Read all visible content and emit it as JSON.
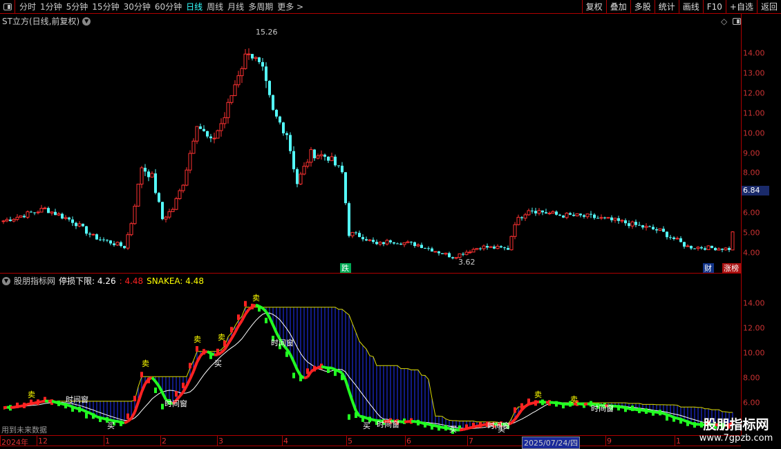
{
  "toolbar": {
    "periods": [
      "分时",
      "1分钟",
      "5分钟",
      "15分钟",
      "30分钟",
      "60分钟",
      "日线",
      "周线",
      "月线",
      "多周期",
      "更多 >"
    ],
    "active": "日线",
    "right_buttons": [
      "复权",
      "叠加",
      "多股",
      "统计",
      "画线",
      "F10",
      "+自选",
      "返回"
    ]
  },
  "main_chart": {
    "title": "ST立方(日线,前复权)",
    "yticks": [
      "14.00",
      "13.00",
      "12.00",
      "11.00",
      "10.00",
      "9.00",
      "8.00",
      "6.00",
      "5.00",
      "4.00"
    ],
    "current_price": "6.84",
    "high_label": "15.26",
    "low_label": "3.62",
    "markers": {
      "die": "跌",
      "cai": "财",
      "zhangbang": "涨榜"
    },
    "price_path": [
      [
        0,
        5.6
      ],
      [
        12,
        6.2
      ],
      [
        20,
        5.6
      ],
      [
        26,
        4.8
      ],
      [
        35,
        4.3
      ],
      [
        37,
        5.5
      ],
      [
        40,
        8.3
      ],
      [
        43,
        7.8
      ],
      [
        46,
        5.7
      ],
      [
        49,
        6.2
      ],
      [
        52,
        7.5
      ],
      [
        56,
        10.5
      ],
      [
        60,
        9.5
      ],
      [
        64,
        10.8
      ],
      [
        68,
        13.0
      ],
      [
        71,
        14.2
      ],
      [
        75,
        13.0
      ],
      [
        78,
        11.0
      ],
      [
        82,
        10.0
      ],
      [
        85,
        7.5
      ],
      [
        89,
        9.0
      ],
      [
        94,
        8.8
      ],
      [
        98,
        8.0
      ],
      [
        100,
        5.0
      ],
      [
        104,
        4.8
      ],
      [
        108,
        4.4
      ],
      [
        112,
        4.6
      ],
      [
        120,
        4.4
      ],
      [
        130,
        3.8
      ],
      [
        138,
        4.3
      ],
      [
        146,
        4.2
      ],
      [
        148,
        5.5
      ],
      [
        152,
        6.2
      ],
      [
        160,
        5.9
      ],
      [
        170,
        5.8
      ],
      [
        180,
        5.5
      ],
      [
        190,
        5.1
      ],
      [
        198,
        4.3
      ],
      [
        210,
        4.2
      ],
      [
        211,
        5.0
      ]
    ],
    "colors": {
      "up": "#ff3232",
      "down": "#54fcfc"
    }
  },
  "indicator": {
    "name": "股朋指标网",
    "label": "停损下限: 4.26",
    "value2": ": 4.48",
    "snake": "SNAKEA: 4.48",
    "yticks": [
      "14.00",
      "12.00",
      "10.00",
      "8.00",
      "6.00"
    ],
    "signals": {
      "sell": "卖",
      "buy": "买",
      "window": "时间窗"
    },
    "future_note": "用到未来数据"
  },
  "date_axis": {
    "labels": [
      "2024年",
      "12",
      "1",
      "2",
      "3",
      "4",
      "5",
      "6",
      "7",
      "9",
      "1"
    ],
    "highlight": "2025/07/24/四"
  },
  "watermark": {
    "line1": "股朋指标网",
    "line2": "www.7gpzb.com"
  }
}
